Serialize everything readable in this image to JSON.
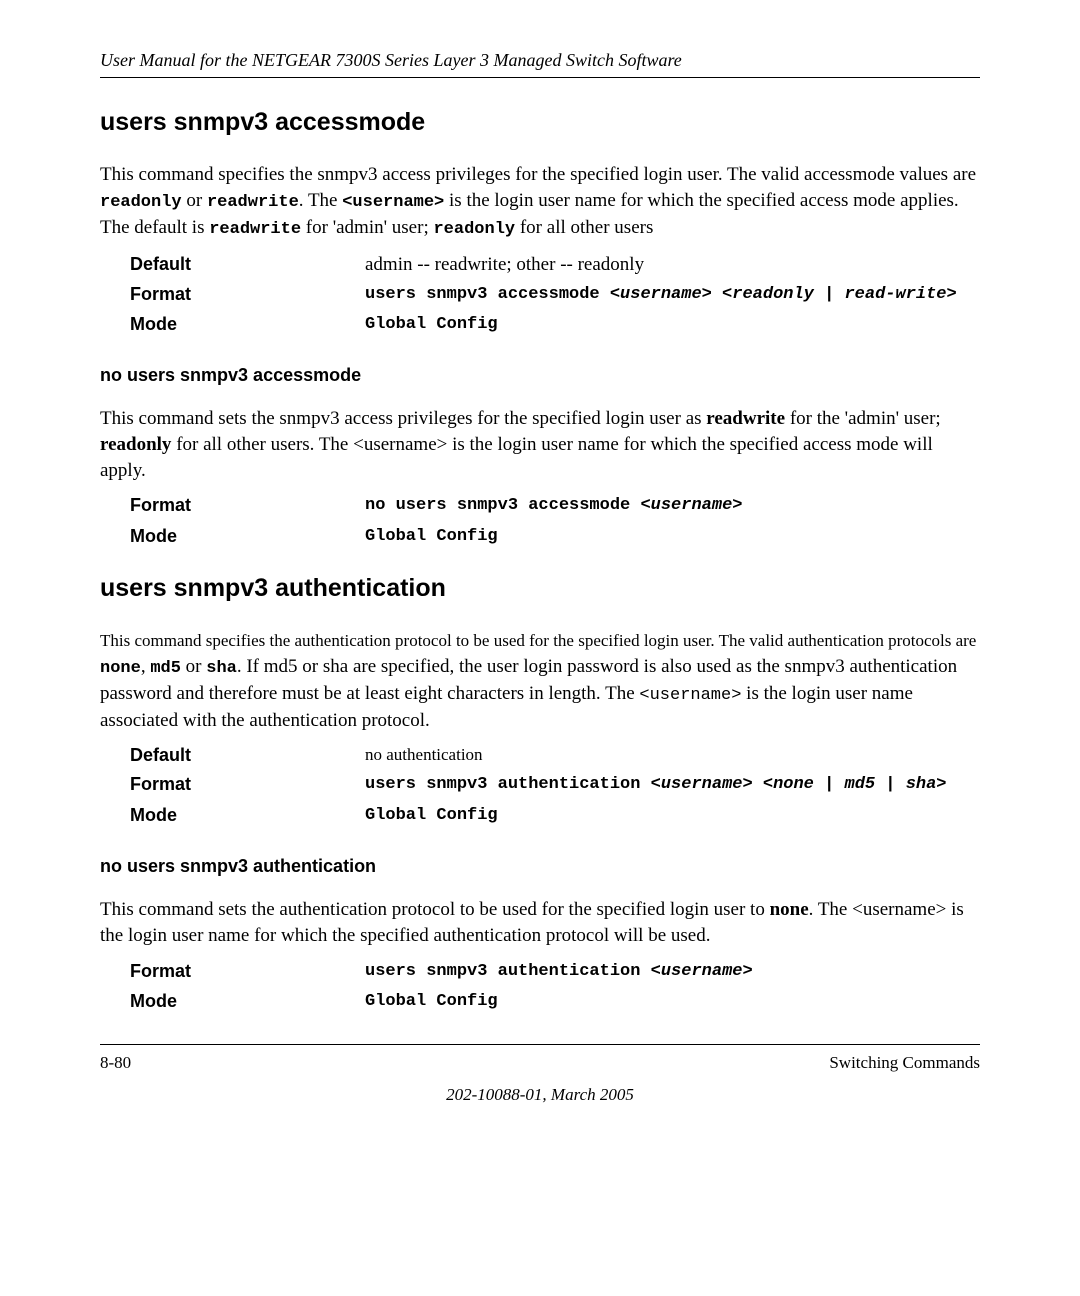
{
  "header": "User Manual for the NETGEAR 7300S Series Layer 3 Managed Switch Software",
  "section1": {
    "title": "users snmpv3 accessmode",
    "para_pre": "This command specifies the snmpv3 access privileges for the specified login user. The valid accessmode values are ",
    "mono1": "readonly",
    "para_mid1": " or ",
    "mono2": "readwrite",
    "para_mid2": ". The ",
    "mono3": "<username>",
    "para_mid3": " is the login user name for which the specified access mode applies. The default is ",
    "mono4": "readwrite",
    "para_mid4": " for 'admin' user; ",
    "mono5": "readonly",
    "para_end": " for all other users",
    "default_label": "Default",
    "default_value": "admin -- readwrite; other -- readonly",
    "format_label": "Format",
    "format_value": "users snmpv3 accessmode <username> <readonly | read-write>",
    "format_literal": "users snmpv3 accessmode ",
    "format_param": "<username> <readonly | read-write>",
    "mode_label": "Mode",
    "mode_value": "Global Config"
  },
  "section1no": {
    "title": "no users snmpv3 accessmode",
    "para_pre": "This command sets the snmpv3 access privileges for the specified login user as ",
    "bold1": "readwrite",
    "para_mid1": " for the 'admin' user; ",
    "bold2": "readonly",
    "para_end": " for all other users. The <username> is the login user name for which the specified access mode will apply.",
    "format_label": "Format",
    "format_literal": "no users snmpv3 accessmode ",
    "format_param": "<username>",
    "mode_label": "Mode",
    "mode_value": "Global Config"
  },
  "section2": {
    "title": "users snmpv3 authentication",
    "para_pre": "This command specifies the authentication protocol to be used for the specified login user. The valid authentication protocols are ",
    "mono1": "none",
    "sep1": ", ",
    "mono2": "md5",
    "sep2": " or ",
    "mono3": "sha",
    "para_mid": ". If md5 or sha are specified, the user login password is also used as the snmpv3 authentication password and therefore must be at least eight characters in length. The ",
    "mono4": "<username>",
    "para_end": " is the login user name associated with the authentication protocol.",
    "default_label": "Default",
    "default_value": "no authentication",
    "format_label": "Format",
    "format_literal": "users snmpv3 authentication ",
    "format_param": "<username> <none | md5 | sha>",
    "mode_label": "Mode",
    "mode_value": "Global Config"
  },
  "section2no": {
    "title": "no users snmpv3 authentication",
    "para_pre": "This command sets the authentication protocol to be used for the specified login user to ",
    "bold1": "none",
    "para_end": ". The <username> is the login user name for which the specified authentication protocol will be used.",
    "format_label": "Format",
    "format_literal": "users snmpv3 authentication ",
    "format_param": "<username>",
    "mode_label": "Mode",
    "mode_value": "Global Config"
  },
  "footer": {
    "left": "8-80",
    "right": "Switching Commands",
    "center": "202-10088-01, March 2005"
  }
}
